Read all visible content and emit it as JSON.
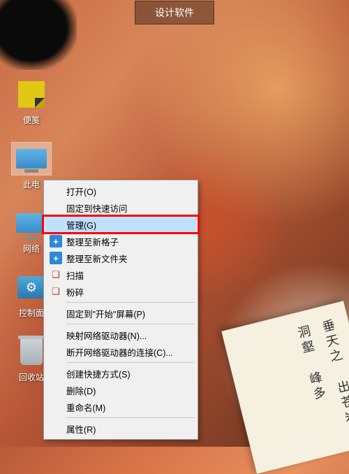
{
  "top_tab": {
    "label": "设计软件"
  },
  "desktop_icons": {
    "sticky": {
      "label": "便笺"
    },
    "this_pc": {
      "label": "此电"
    },
    "network": {
      "label": "网络"
    },
    "control_panel": {
      "label": "控制面"
    },
    "recycle_bin": {
      "label": "回收站"
    }
  },
  "context_menu": {
    "open": "打开(O)",
    "pin_quick": "固定到快速访问",
    "manage": "管理(G)",
    "tidy_grid": "整理至新格子",
    "tidy_folder": "整理至新文件夹",
    "scan": "扫描",
    "shred": "粉碎",
    "pin_start": "固定到\"开始\"屏幕(P)",
    "map_drive": "映射网络驱动器(N)...",
    "disconnect_drive": "断开网络驱动器的连接(C)...",
    "create_shortcut": "创建快捷方式(S)",
    "delete": "删除(D)",
    "rename": "重命名(M)",
    "properties": "属性(R)"
  },
  "book_text": "垂天之  出苍岩  洞壑  峰多"
}
